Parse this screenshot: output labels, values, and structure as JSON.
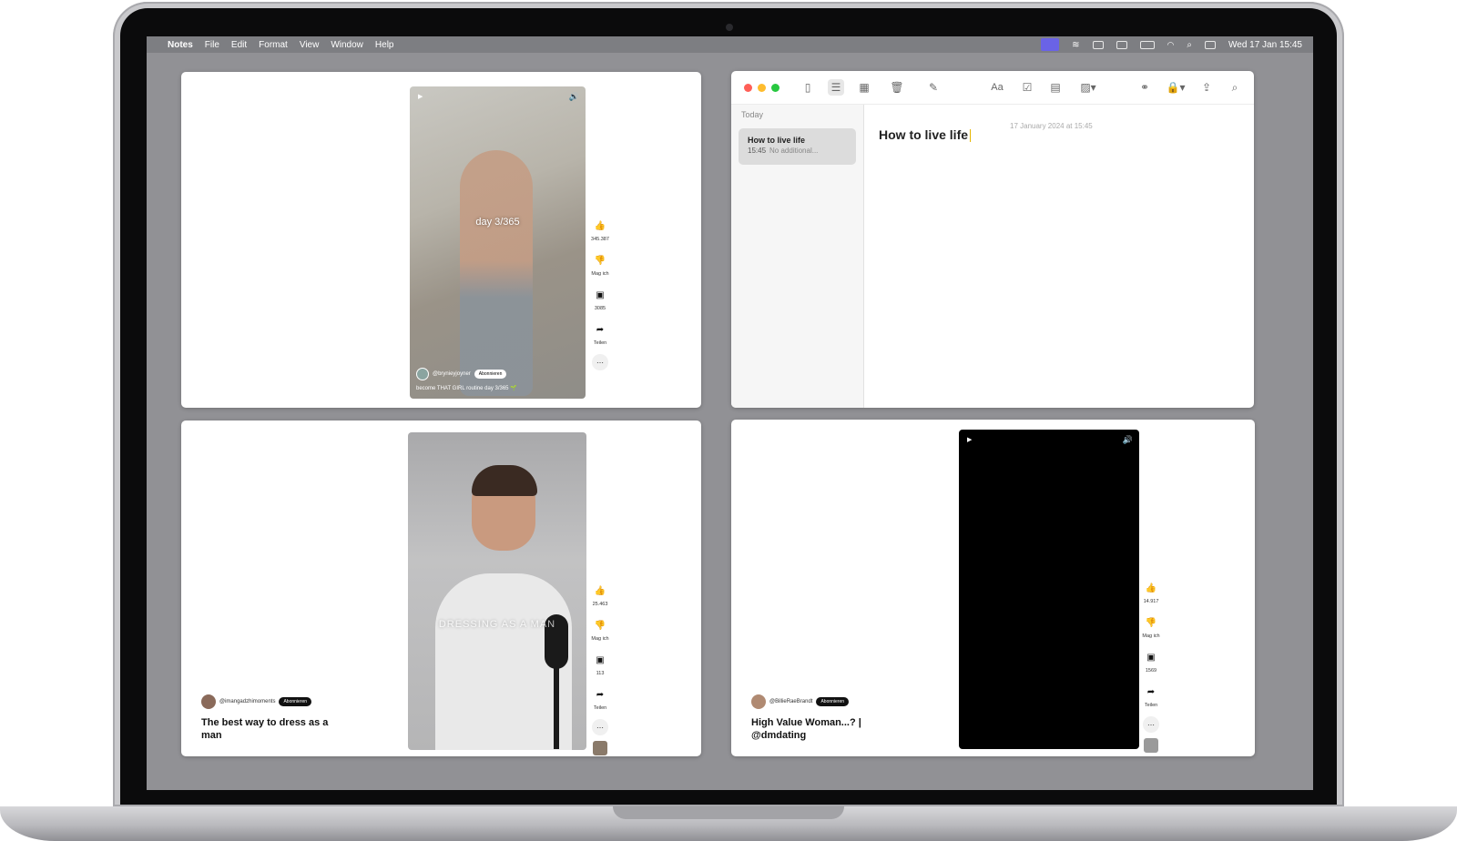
{
  "menubar": {
    "app_name": "Notes",
    "items": [
      "File",
      "Edit",
      "Format",
      "View",
      "Window",
      "Help"
    ],
    "datetime": "Wed 17 Jan  15:45"
  },
  "video1": {
    "overlay_text": "day 3/365",
    "channel": "@brynieyjoyner",
    "subscribe_label": "Abonnieren",
    "caption": "become THAT GIRL routine day 3/365 🌱",
    "likes": "345.387",
    "dislike_label": "Mag ich",
    "comments": "3085",
    "share_label": "Teilen"
  },
  "notes": {
    "section": "Today",
    "item_title": "How to live life",
    "item_time": "15:45",
    "item_preview": "No additional...",
    "date_line": "17 January 2024 at 15:45",
    "note_title": "How to live life",
    "font_button_label": "Aa"
  },
  "video3": {
    "overlay_text": "DRESSING AS A MAN",
    "channel": "@imangadzhimoments",
    "subscribe_label": "Abonnieren",
    "title": "The best way to dress as a man",
    "likes": "25.463",
    "dislike_label": "Mag ich",
    "comments": "113",
    "share_label": "Teilen"
  },
  "video4": {
    "channel": "@BillieRaeBrandt",
    "subscribe_label": "Abonnieren",
    "title": "High Value Woman...? | @dmdating",
    "likes": "14.917",
    "dislike_label": "Mag ich",
    "comments": "1569",
    "share_label": "Teilen"
  },
  "icons": {
    "like": "thumbs-up-icon",
    "dislike": "thumbs-down-icon",
    "comment": "comment-icon",
    "share": "share-icon",
    "more": "more-icon"
  },
  "colors": {
    "desktop": "#919195",
    "screen_recording_active": "#6a63e6",
    "caret": "#e6b600"
  }
}
